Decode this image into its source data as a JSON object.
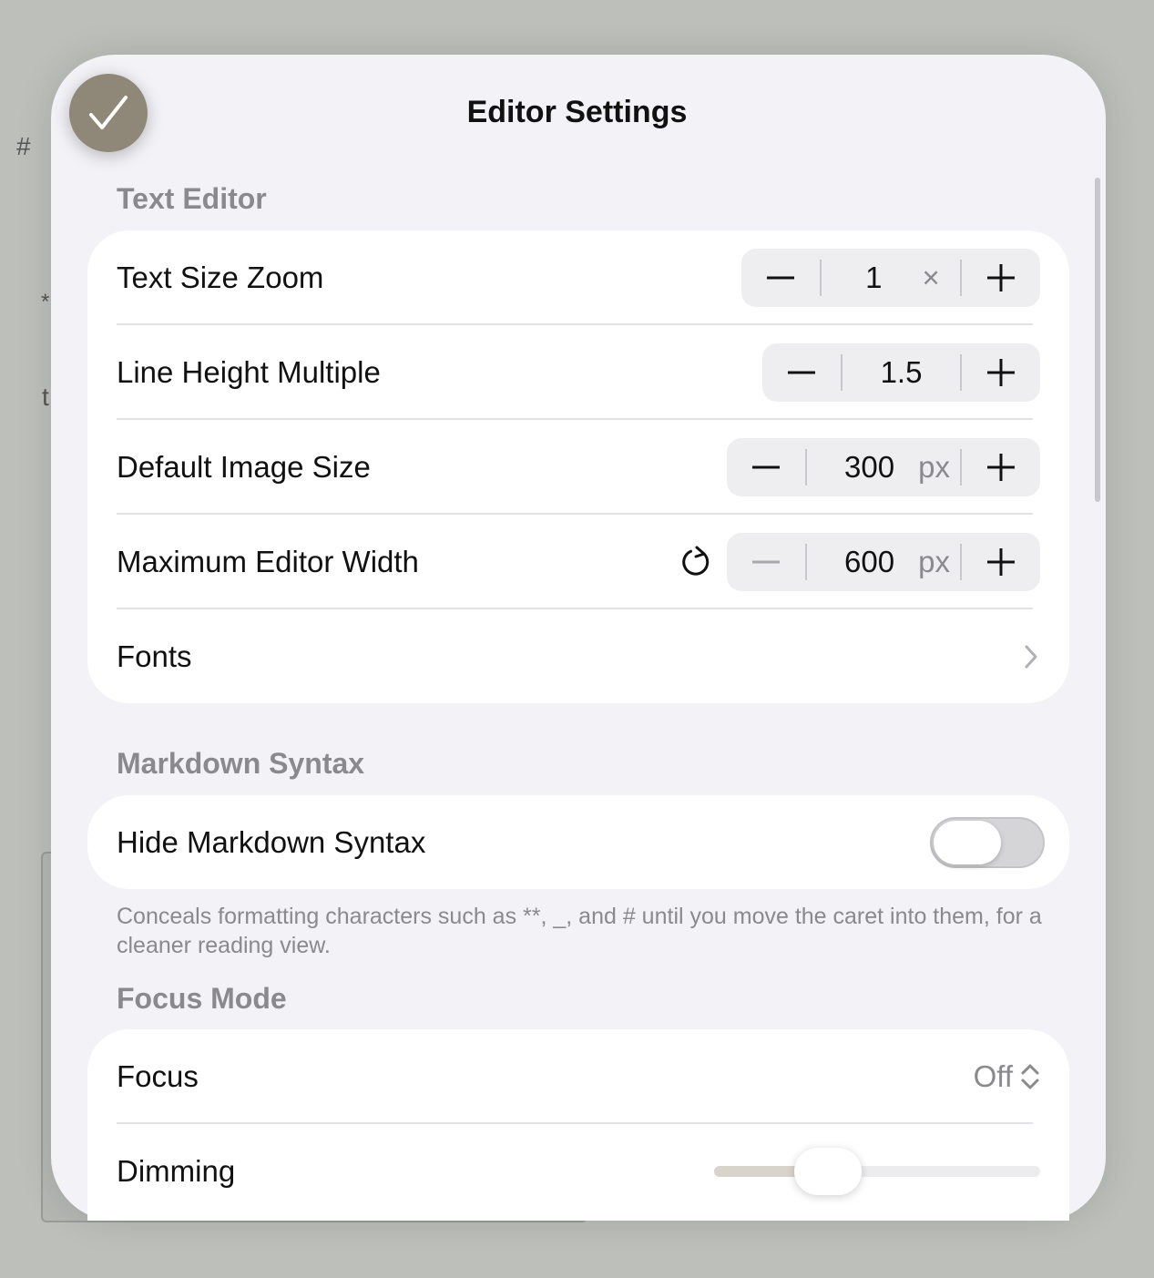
{
  "background": {
    "fragments": [
      "#",
      "*",
      "t"
    ]
  },
  "header": {
    "title": "Editor Settings",
    "done_icon": "checkmark-icon"
  },
  "text_editor": {
    "section_title": "Text Editor",
    "rows": {
      "text_size_zoom": {
        "label": "Text Size Zoom",
        "value": "1",
        "unit": "×",
        "decrement": "−",
        "increment": "+"
      },
      "line_height": {
        "label": "Line Height Multiple",
        "value": "1.5",
        "unit": "",
        "decrement": "−",
        "increment": "+"
      },
      "image_size": {
        "label": "Default Image Size",
        "value": "300",
        "unit": "px",
        "decrement": "−",
        "increment": "+"
      },
      "editor_width": {
        "label": "Maximum Editor Width",
        "value": "600",
        "unit": "px",
        "decrement": "−",
        "increment": "+",
        "reset_icon": "reset-icon"
      },
      "fonts": {
        "label": "Fonts",
        "chevron_icon": "chevron-right-icon"
      }
    }
  },
  "markdown_syntax": {
    "section_title": "Markdown Syntax",
    "hide_syntax": {
      "label": "Hide Markdown Syntax",
      "enabled": false
    },
    "footnote": "Conceals formatting characters such as **, _, and # until you move the caret into them, for a cleaner reading view."
  },
  "focus_mode": {
    "section_title": "Focus Mode",
    "focus": {
      "label": "Focus",
      "value": "Off",
      "icon": "up-down-chevron-icon"
    },
    "dimming": {
      "label": "Dimming",
      "level": 0.32
    }
  },
  "colors": {
    "accent": "#8f8878",
    "sheet_bg": "#f2f2f7",
    "secondary_text": "#8a8a8e"
  }
}
